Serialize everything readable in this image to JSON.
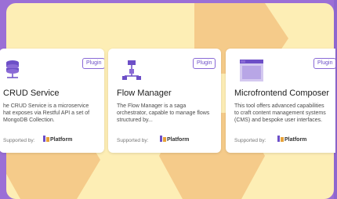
{
  "colors": {
    "background_left": "#9b6fd6",
    "panel": "#fdeeb5",
    "hex_shape": "#f5cb8a",
    "accent": "#6d4fc7"
  },
  "cards": [
    {
      "badge": "Plugin",
      "title": "CRUD Service",
      "desc_lines": [
        "he CRUD Service is a microservice",
        "hat exposes via Restful API a set of",
        "MongoDB Collection."
      ],
      "supported_label": "Supported by:",
      "logo_text": "Platform",
      "icon": "database-icon"
    },
    {
      "badge": "Plugin",
      "title": "Flow Manager",
      "desc_lines": [
        "The Flow Manager is a saga",
        "orchestrator, capable to manage flows",
        "structured by..."
      ],
      "supported_label": "Supported by:",
      "logo_text": "Platform",
      "icon": "flow-diagram-icon"
    },
    {
      "badge": "Plugin",
      "title": "Microfrontend Composer",
      "desc_lines": [
        "This tool offers advanced capabilities",
        "to craft content management systems",
        "(CMS) and bespoke user interfaces."
      ],
      "supported_label": "Supported by:",
      "logo_text": "Platform",
      "icon": "layout-window-icon"
    }
  ]
}
